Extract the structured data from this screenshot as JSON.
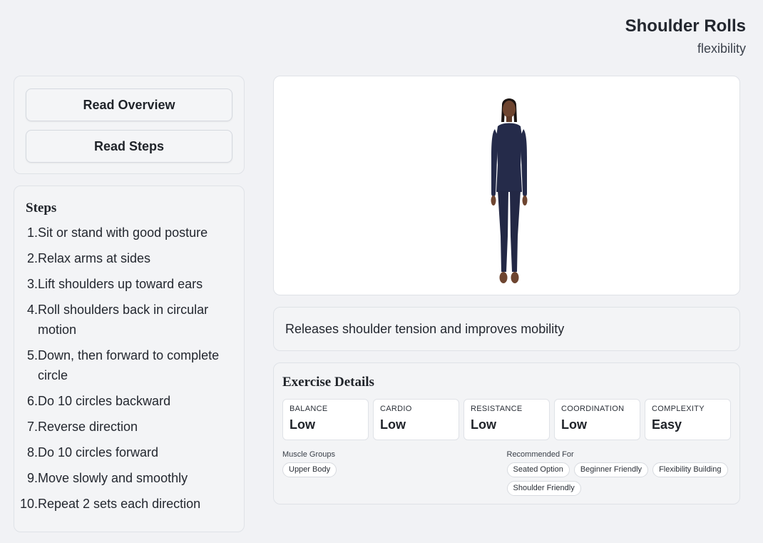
{
  "header": {
    "title": "Shoulder Rolls",
    "subtitle": "flexibility"
  },
  "actions": {
    "overview_label": "Read Overview",
    "steps_label": "Read Steps"
  },
  "steps": {
    "heading": "Steps",
    "items": [
      {
        "num": "1.",
        "text": "Sit or stand with good posture"
      },
      {
        "num": "2.",
        "text": "Relax arms at sides"
      },
      {
        "num": "3.",
        "text": "Lift shoulders up toward ears"
      },
      {
        "num": "4.",
        "text": "Roll shoulders back in circular motion"
      },
      {
        "num": "5.",
        "text": "Down, then forward to complete circle"
      },
      {
        "num": "6.",
        "text": "Do 10 circles backward"
      },
      {
        "num": "7.",
        "text": "Reverse direction"
      },
      {
        "num": "8.",
        "text": "Do 10 circles forward"
      },
      {
        "num": "9.",
        "text": "Move slowly and smoothly"
      },
      {
        "num": "10.",
        "text": "Repeat 2 sets each direction"
      }
    ]
  },
  "description": "Releases shoulder tension and improves mobility",
  "details": {
    "heading": "Exercise Details",
    "stats": [
      {
        "label": "BALANCE",
        "value": "Low"
      },
      {
        "label": "CARDIO",
        "value": "Low"
      },
      {
        "label": "RESISTANCE",
        "value": "Low"
      },
      {
        "label": "COORDINATION",
        "value": "Low"
      },
      {
        "label": "COMPLEXITY",
        "value": "Easy"
      }
    ],
    "muscle_groups_label": "Muscle Groups",
    "muscle_groups": [
      "Upper Body"
    ],
    "recommended_label": "Recommended For",
    "recommended": [
      "Seated Option",
      "Beginner Friendly",
      "Flexibility Building",
      "Shoulder Friendly"
    ]
  },
  "colors": {
    "background": "#f1f2f5",
    "outfit": "#252b4a",
    "skin": "#6e4530"
  }
}
